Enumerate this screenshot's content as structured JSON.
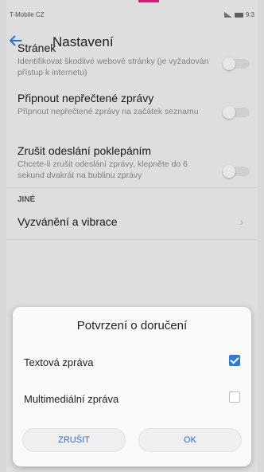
{
  "status_bar": {
    "carrier": "T-Mobile CZ",
    "time": "9:3"
  },
  "header": {
    "title": "Nastavení",
    "back_icon": "arrow-left-icon"
  },
  "settings": [
    {
      "title": "Stránek",
      "description": "Identifikovat škodlivé webové stránky (je vyžadován přístup k internetu)",
      "enabled": false
    },
    {
      "title": "Připnout nepřečtené zprávy",
      "description": "Připnout nepřečtené zprávy na začátek seznamu",
      "enabled": false
    },
    {
      "title": "Zrušit odeslání poklepáním",
      "description": "Chcete-li zrušit odeslání zprávy, klepněte do 6 sekund dvakrát na bublinu zprávy",
      "enabled": false
    }
  ],
  "section": {
    "label": "JINÉ"
  },
  "nav_item": {
    "label": "Vyzvánění a vibrace"
  },
  "dialog": {
    "title": "Potvrzení o doručení",
    "options": [
      {
        "label": "Textová zpráva",
        "checked": true
      },
      {
        "label": "Multimediální zpráva",
        "checked": false
      }
    ],
    "cancel_label": "ZRUŠIT",
    "ok_label": "OK"
  },
  "colors": {
    "accent": "#2f7ad9",
    "brand_mark": "#e0217d"
  }
}
